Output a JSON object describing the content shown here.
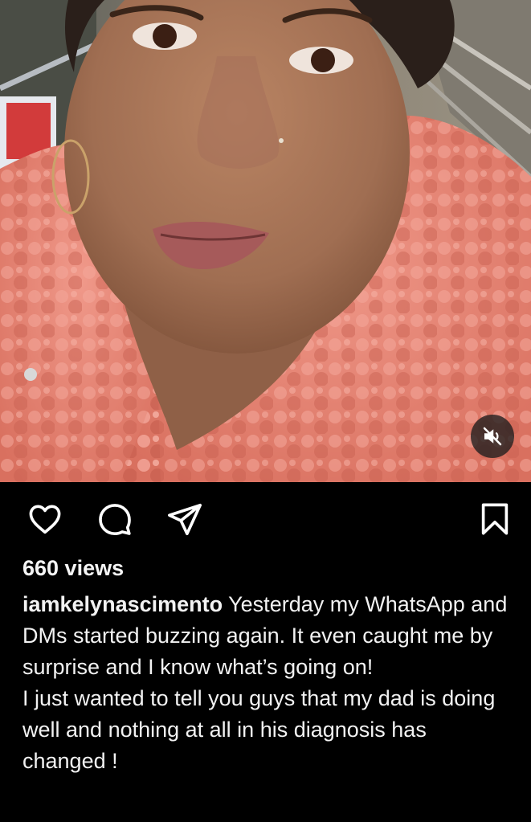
{
  "post": {
    "views": "660 views",
    "username": "iamkelynascimento",
    "caption_part1": "Yesterday my WhatsApp and DMs started buzzing again. It even caught me by surprise and I know what’s going on!",
    "caption_part2": "I just wanted to tell you guys that my dad is doing well and nothing at all in his diagnosis has changed !"
  },
  "icons": {
    "like": "heart-icon",
    "comment": "speech-bubble-icon",
    "share": "paper-plane-icon",
    "save": "bookmark-icon",
    "mute": "speaker-muted-icon"
  },
  "colors": {
    "background": "#000000",
    "text": "#f5f5f5",
    "coat": "#e8877a"
  }
}
